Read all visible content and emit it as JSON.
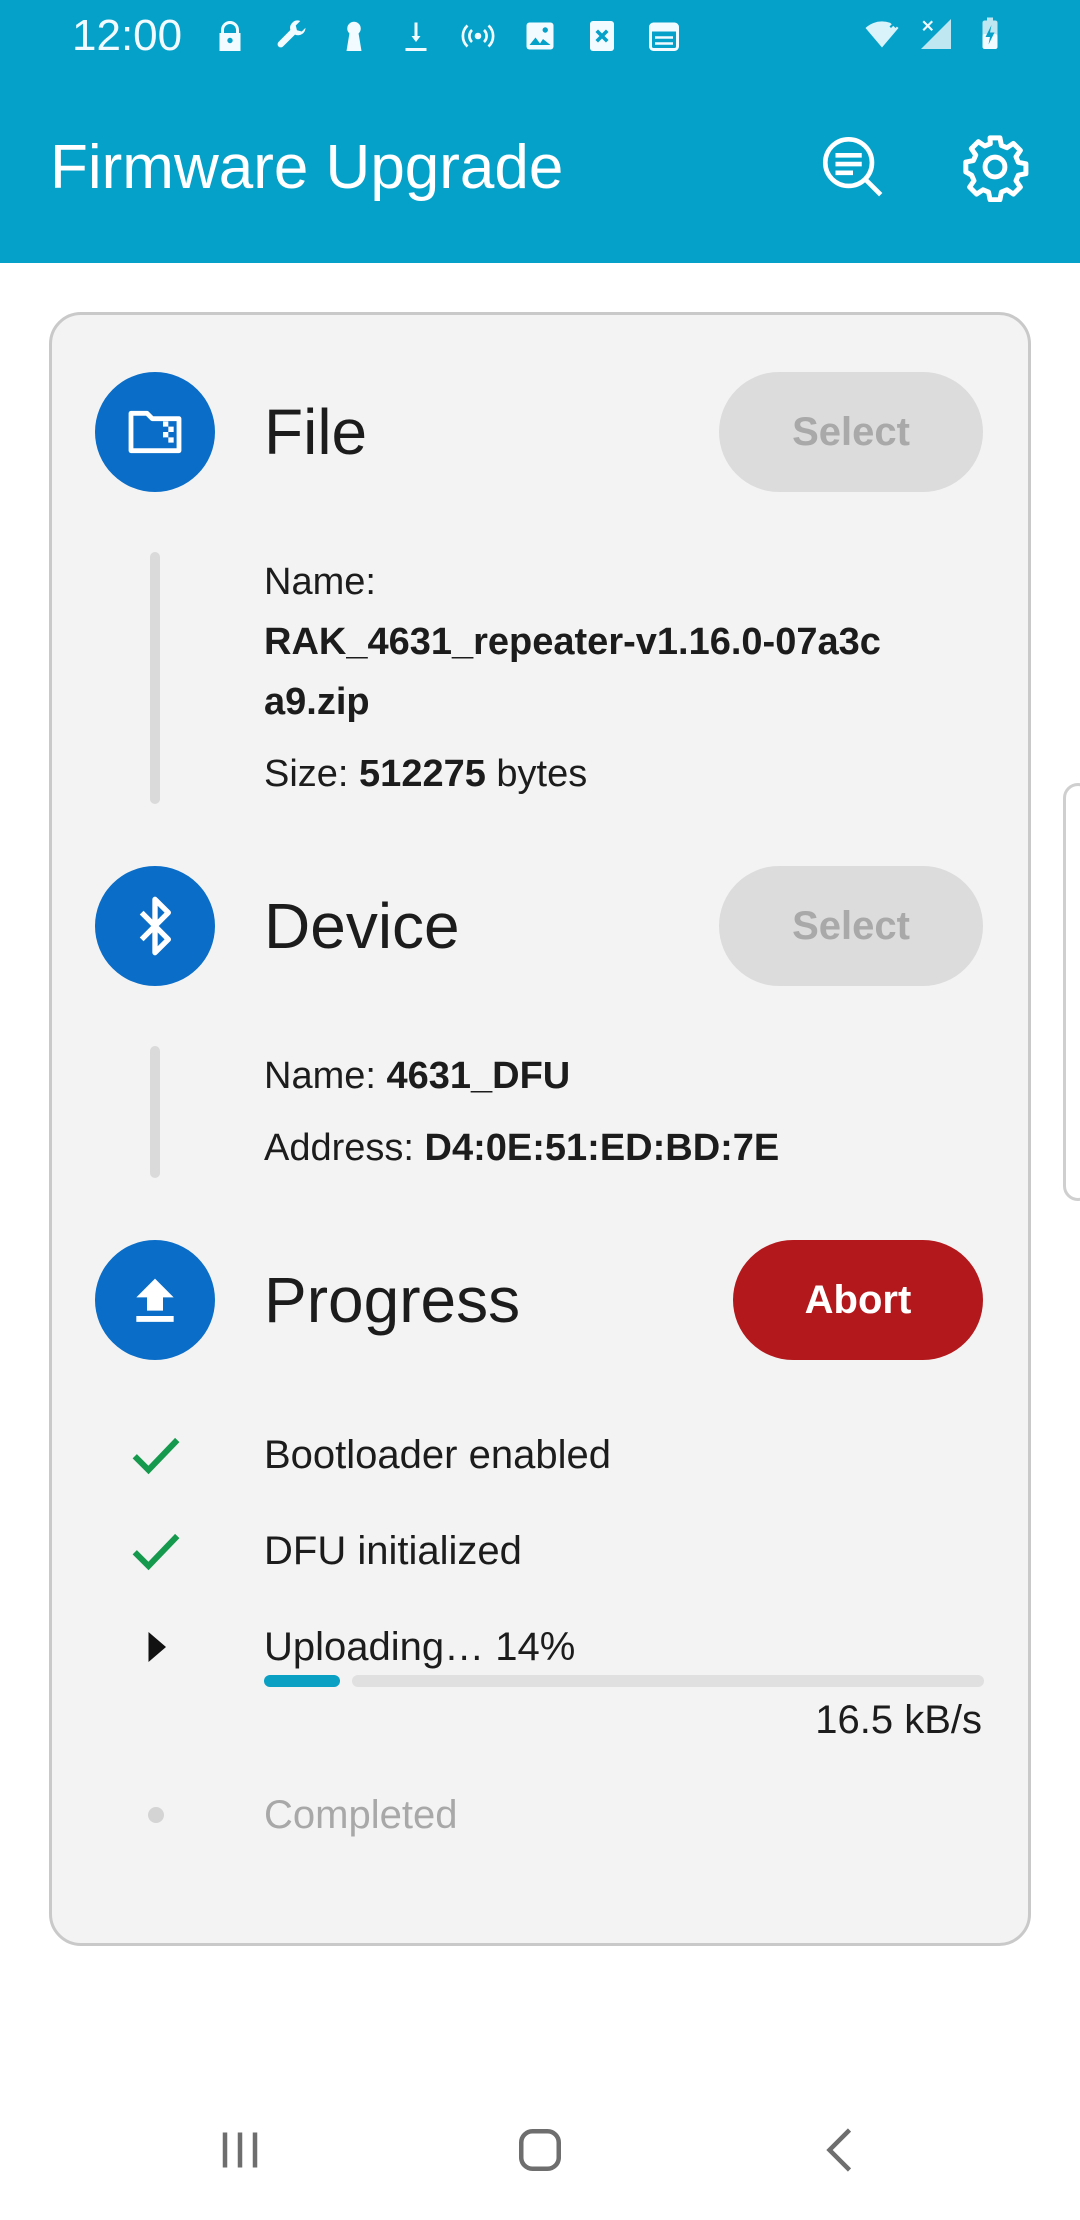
{
  "status_bar": {
    "time": "12:00",
    "left_icons": [
      "lock-icon",
      "wrench-icon",
      "keyhole-icon",
      "download-icon",
      "hotspot-icon",
      "image-icon",
      "close-box-icon",
      "calendar-icon"
    ],
    "right_icons": [
      "wifi-icon",
      "cell-signal-icon",
      "battery-charging-icon"
    ]
  },
  "app_bar": {
    "title": "Firmware Upgrade",
    "actions": [
      "scan-search-icon",
      "settings-gear-icon"
    ]
  },
  "steps": {
    "file": {
      "title": "File",
      "button": "Select",
      "name_label": "Name:",
      "name_line1": "RAK_4631_repeater-v1.16.0-07a3c",
      "name_line2": "a9.zip",
      "size_label": "Size:",
      "size_value": "512275",
      "size_unit": "bytes"
    },
    "device": {
      "title": "Device",
      "button": "Select",
      "name_label": "Name:",
      "name_value": "4631_DFU",
      "address_label": "Address:",
      "address_value": "D4:0E:51:ED:BD:7E"
    },
    "progress": {
      "title": "Progress",
      "button": "Abort",
      "tasks": [
        {
          "label": "Bootloader enabled",
          "state": "done"
        },
        {
          "label": "DFU initialized",
          "state": "done"
        },
        {
          "label": "Uploading… 14%",
          "state": "active"
        },
        {
          "label": "Completed",
          "state": "pending"
        }
      ],
      "upload_progress": 0.14,
      "speed": "16.5 kB/s"
    }
  },
  "colors": {
    "app_bar": "#05a1c9",
    "step_circle": "#0a6dc7",
    "abort": "#b3191c",
    "check": "#159a4d",
    "progress_fill": "#0aa0c4"
  },
  "nav_bar": [
    "recents-icon",
    "home-icon",
    "back-icon"
  ]
}
